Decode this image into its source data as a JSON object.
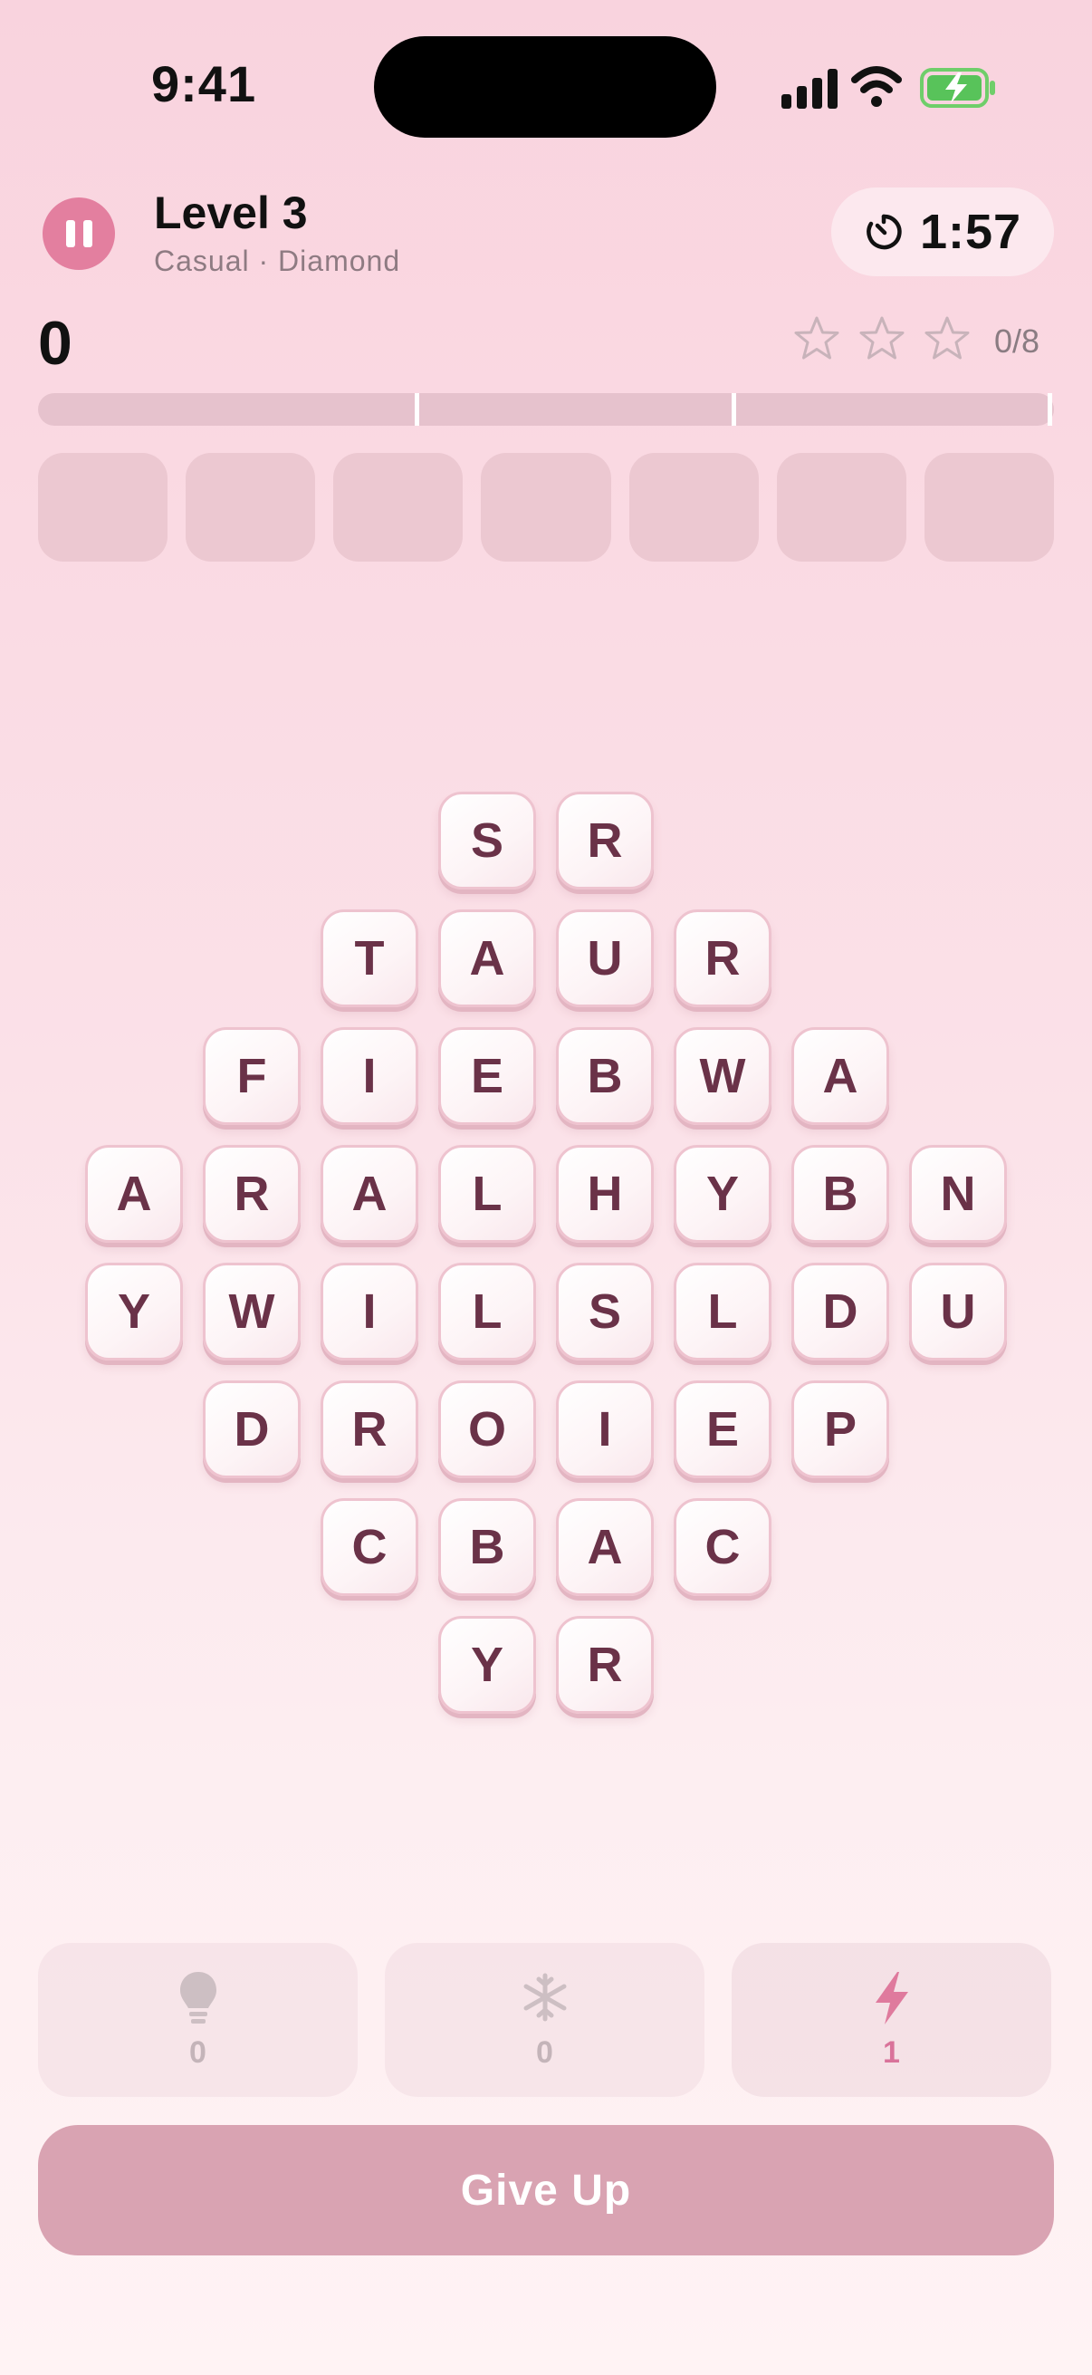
{
  "status_bar": {
    "time": "9:41"
  },
  "header": {
    "level_title": "Level 3",
    "subtitle": "Casual · Diamond",
    "timer": "1:57"
  },
  "score": {
    "value": "0",
    "stars_earned": 0,
    "stars_total": 3,
    "words_found": "0/8"
  },
  "progress": {
    "fraction": 0.0,
    "milestones": 3
  },
  "answer_slots": 7,
  "board": {
    "rows": [
      [
        "S",
        "R"
      ],
      [
        "T",
        "A",
        "U",
        "R"
      ],
      [
        "F",
        "I",
        "E",
        "B",
        "W",
        "A"
      ],
      [
        "A",
        "R",
        "A",
        "L",
        "H",
        "Y",
        "B",
        "N"
      ],
      [
        "Y",
        "W",
        "I",
        "L",
        "S",
        "L",
        "D",
        "U"
      ],
      [
        "D",
        "R",
        "O",
        "I",
        "E",
        "P"
      ],
      [
        "C",
        "B",
        "A",
        "C"
      ],
      [
        "Y",
        "R"
      ]
    ]
  },
  "powerups": [
    {
      "name": "hint",
      "icon": "lightbulb-icon",
      "count": "0",
      "active": false
    },
    {
      "name": "freeze",
      "icon": "snowflake-icon",
      "count": "0",
      "active": false
    },
    {
      "name": "boost",
      "icon": "lightning-icon",
      "count": "1",
      "active": true
    }
  ],
  "actions": {
    "give_up_label": "Give Up"
  },
  "colors": {
    "accent": "#e37f9f",
    "tile_text": "#6a3248",
    "give_up_bg": "#d9a3b2",
    "background_top": "#f9d3de"
  }
}
